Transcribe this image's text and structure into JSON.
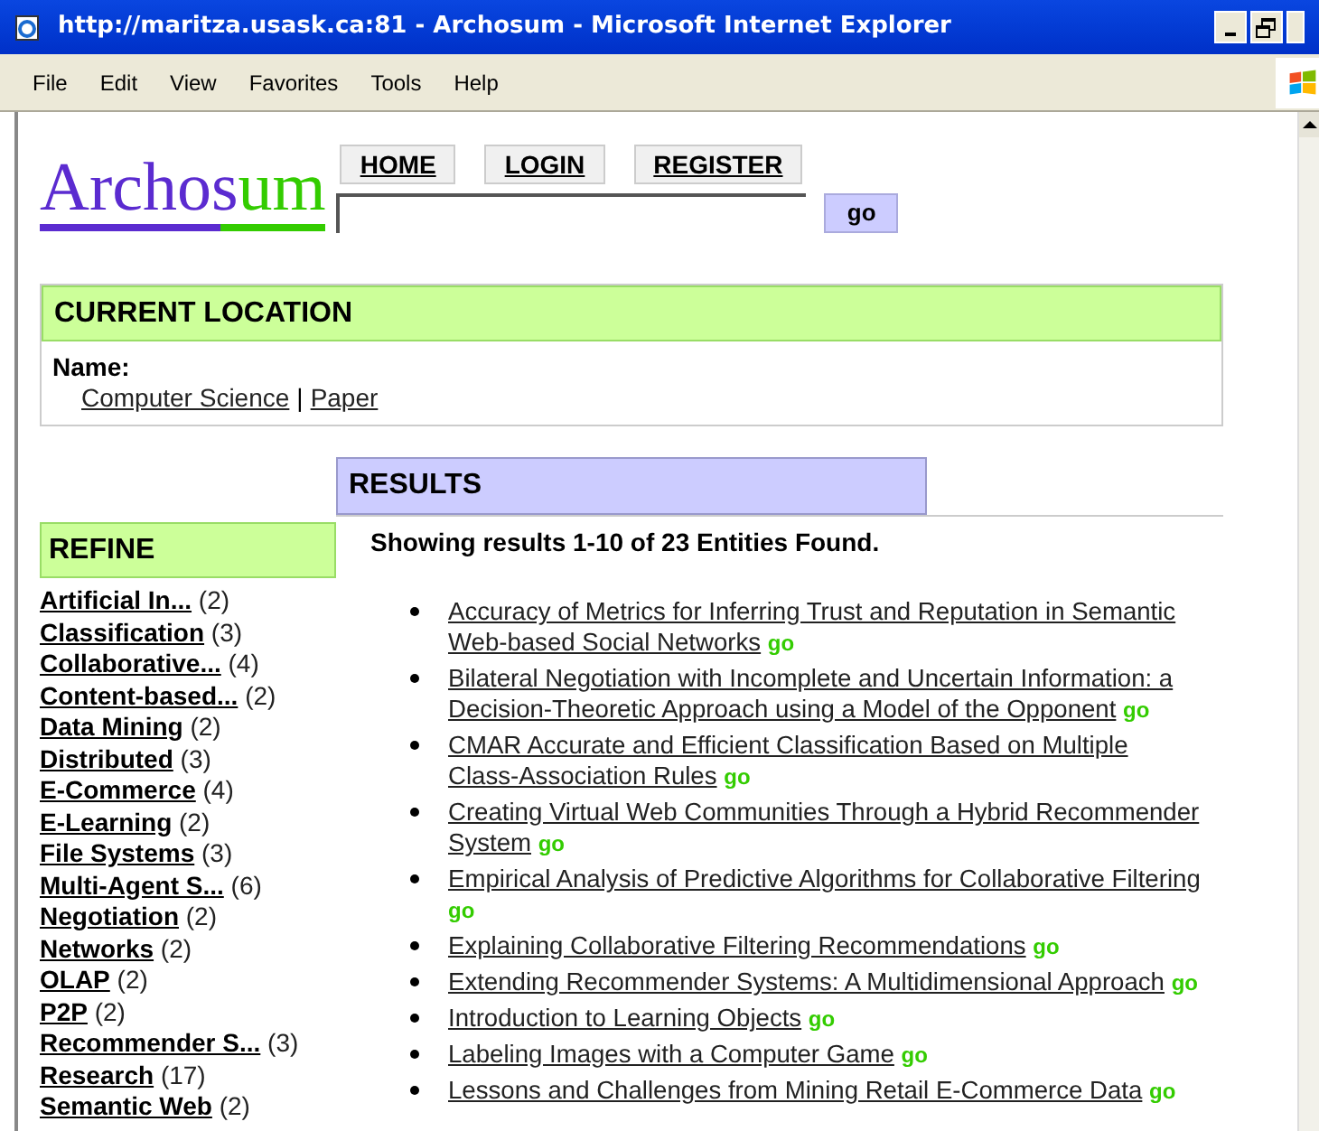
{
  "window": {
    "title": "http://maritza.usask.ca:81 - Archosum - Microsoft Internet Explorer"
  },
  "menu": [
    "File",
    "Edit",
    "View",
    "Favorites",
    "Tools",
    "Help"
  ],
  "logo": {
    "parts": [
      "Archos",
      "um"
    ]
  },
  "nav": [
    "HOME",
    "LOGIN",
    "REGISTER"
  ],
  "search": {
    "button": "go"
  },
  "current_location": {
    "heading": "CURRENT LOCATION",
    "label": "Name:",
    "path": [
      "Computer Science",
      "Paper"
    ],
    "separator": "|"
  },
  "refine": {
    "heading": "REFINE",
    "items": [
      {
        "label": "Artificial In...",
        "count": "(2)"
      },
      {
        "label": "Classification",
        "count": "(3)"
      },
      {
        "label": "Collaborative...",
        "count": "(4)"
      },
      {
        "label": "Content-based...",
        "count": "(2)"
      },
      {
        "label": "Data Mining",
        "count": "(2)"
      },
      {
        "label": "Distributed",
        "count": "(3)"
      },
      {
        "label": "E-Commerce",
        "count": "(4)"
      },
      {
        "label": "E-Learning",
        "count": "(2)"
      },
      {
        "label": "File Systems",
        "count": "(3)"
      },
      {
        "label": "Multi-Agent S...",
        "count": "(6)"
      },
      {
        "label": "Negotiation",
        "count": "(2)"
      },
      {
        "label": "Networks",
        "count": "(2)"
      },
      {
        "label": "OLAP",
        "count": "(2)"
      },
      {
        "label": "P2P",
        "count": "(2)"
      },
      {
        "label": "Recommender S...",
        "count": "(3)"
      },
      {
        "label": "Research",
        "count": "(17)"
      },
      {
        "label": "Semantic Web",
        "count": "(2)"
      }
    ]
  },
  "results": {
    "heading": "RESULTS",
    "summary": "Showing results 1-10 of 23 Entities Found.",
    "items": [
      {
        "title": "Accuracy of Metrics for Inferring Trust and Reputation in Semantic Web-based Social Networks",
        "go": "go"
      },
      {
        "title": "Bilateral Negotiation with Incomplete and Uncertain Information: a Decision-Theoretic Approach using a Model of the Opponent",
        "go": "go"
      },
      {
        "title": "CMAR Accurate and Efficient Classification Based on Multiple Class-Association Rules",
        "go": "go"
      },
      {
        "title": "Creating Virtual Web Communities Through a Hybrid Recommender System",
        "go": "go"
      },
      {
        "title": "Empirical Analysis of Predictive Algorithms for Collaborative Filtering",
        "go": "go"
      },
      {
        "title": "Explaining Collaborative Filtering Recommendations",
        "go": "go"
      },
      {
        "title": "Extending Recommender Systems: A Multidimensional Approach",
        "go": "go"
      },
      {
        "title": "Introduction to Learning Objects",
        "go": "go"
      },
      {
        "title": "Labeling Images with a Computer Game",
        "go": "go"
      },
      {
        "title": "Lessons and Challenges from Mining Retail E-Commerce Data",
        "go": "go"
      }
    ]
  }
}
